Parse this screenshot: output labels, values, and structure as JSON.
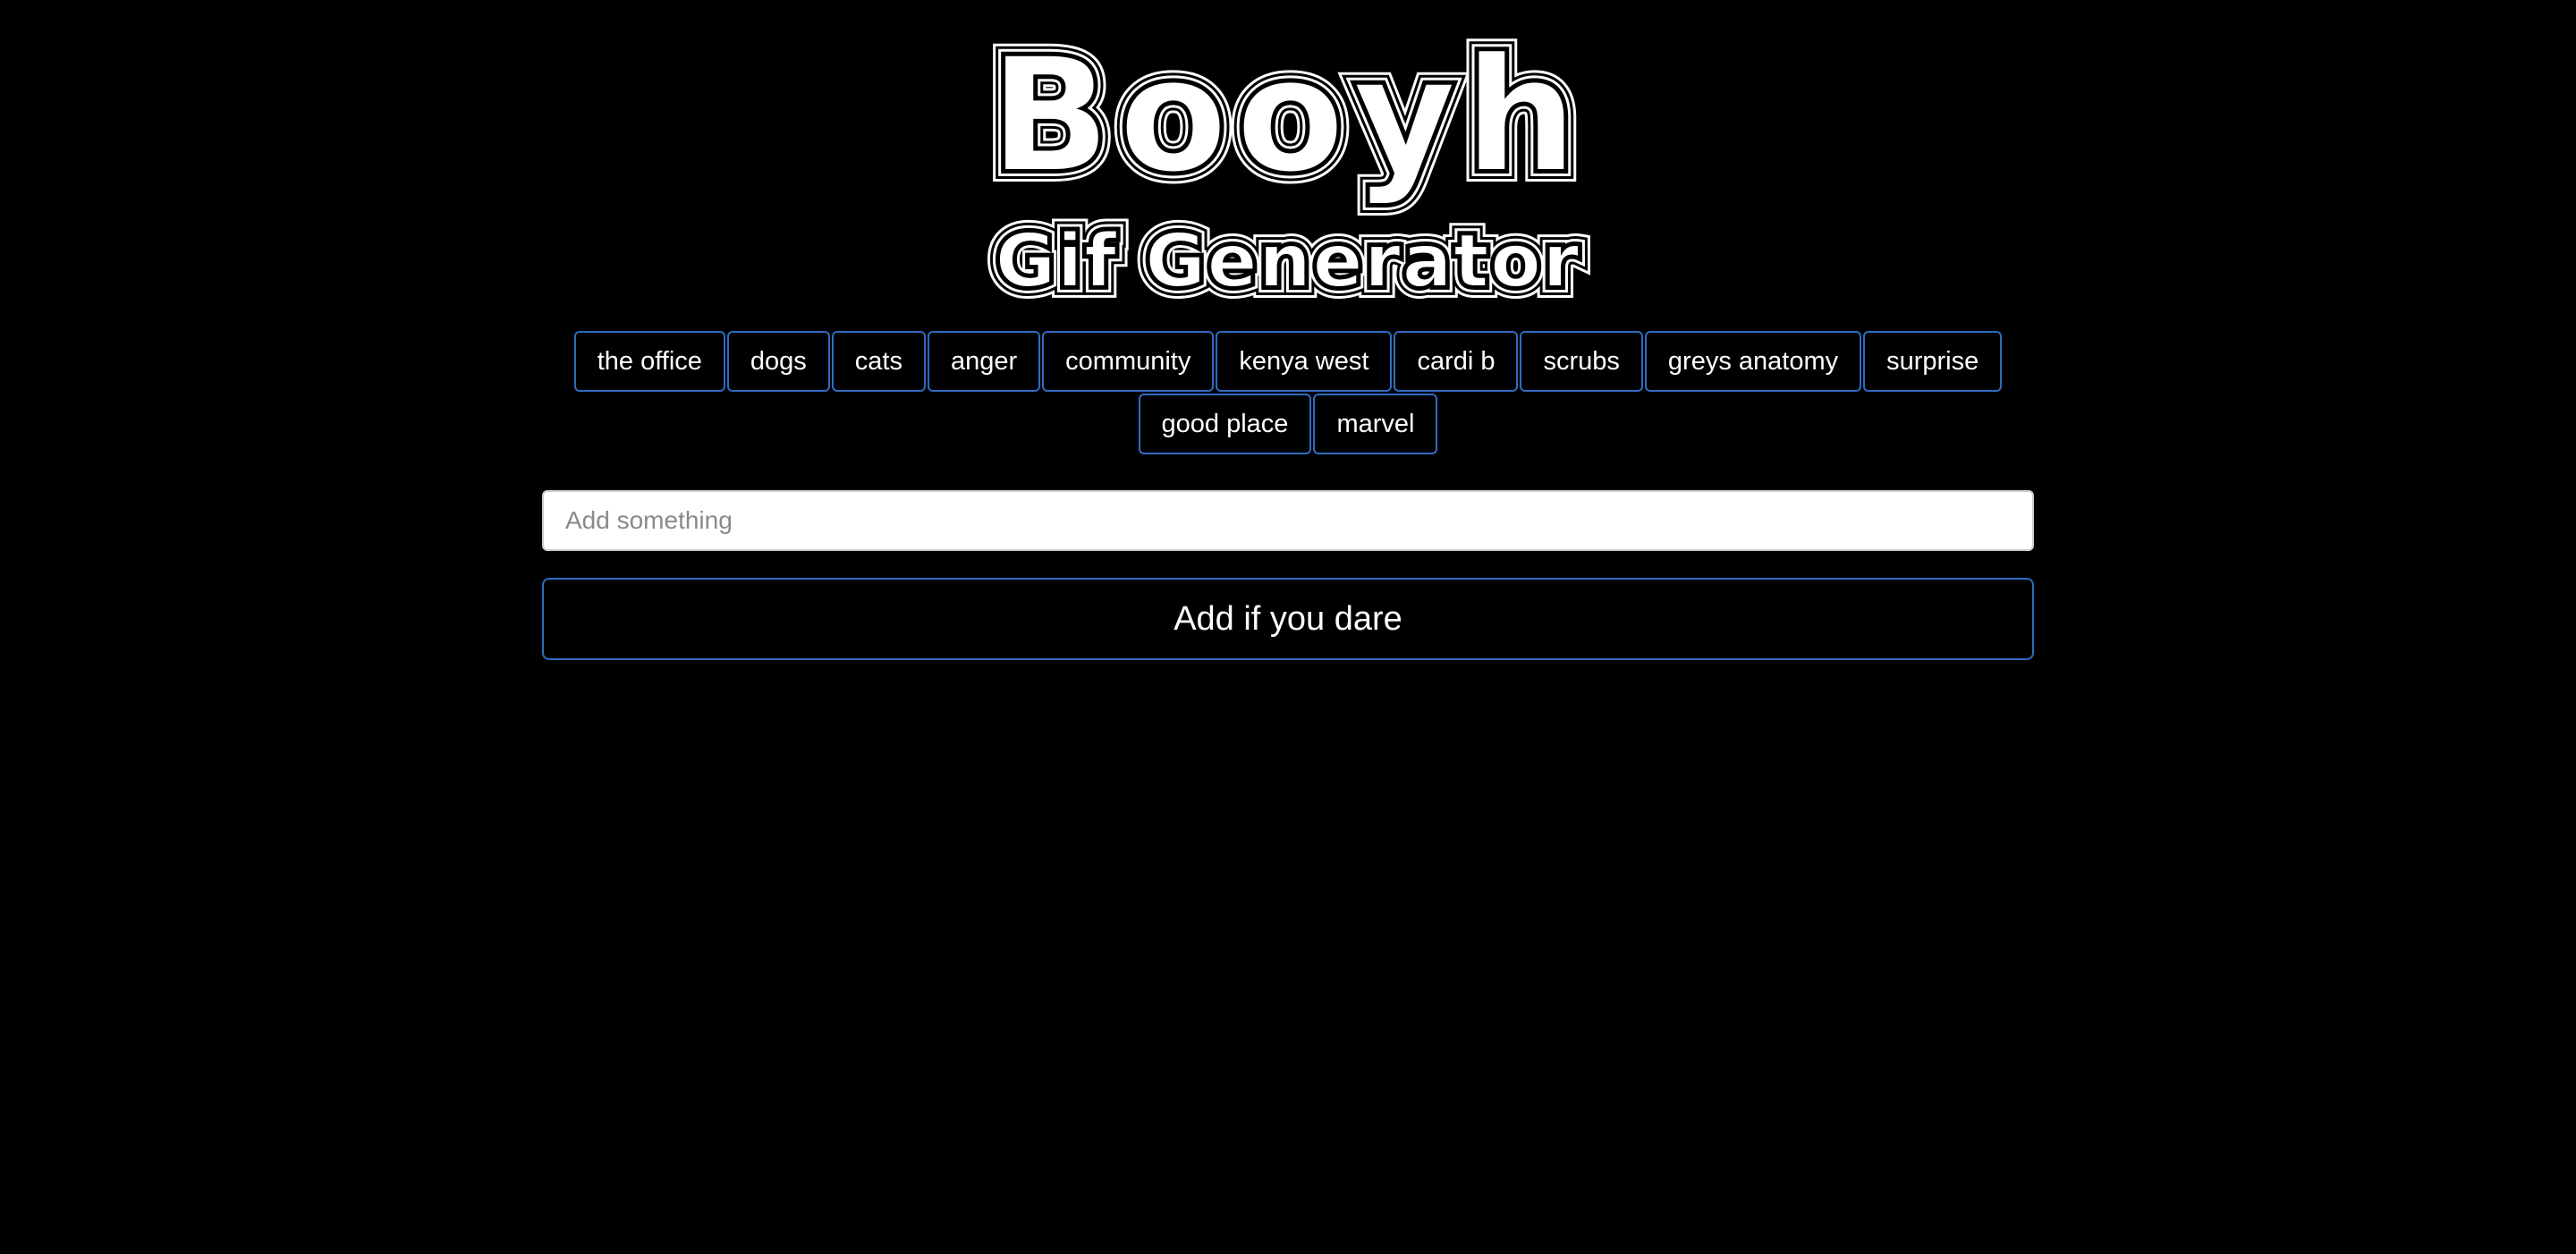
{
  "header": {
    "title": "Booyh",
    "subtitle": "Gif Generator"
  },
  "tags": [
    "the office",
    "dogs",
    "cats",
    "anger",
    "community",
    "kenya west",
    "cardi b",
    "scrubs",
    "greys anatomy",
    "surprise",
    "good place",
    "marvel"
  ],
  "form": {
    "placeholder": "Add something",
    "value": "",
    "submit_label": "Add if you dare"
  },
  "colors": {
    "background": "#000000",
    "accent_border": "#2f6bc0",
    "text": "#ffffff"
  }
}
